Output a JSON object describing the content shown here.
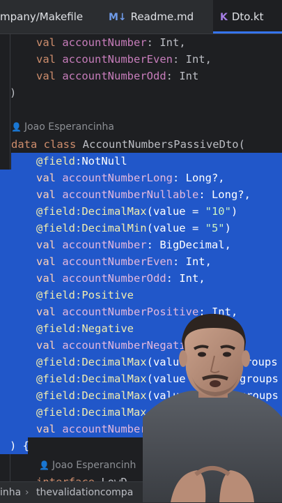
{
  "tabs": [
    {
      "label": "mpany/Makefile",
      "icon": "",
      "active": false
    },
    {
      "label": "Readme.md",
      "icon": "M↓",
      "active": false
    },
    {
      "label": "Dto.kt",
      "icon": "K",
      "active": true
    }
  ],
  "code": {
    "l1_kw": "val",
    "l1_prop": "accountNumber",
    "l1_rest": ": Int,",
    "l2_kw": "val",
    "l2_prop": "accountNumberEven",
    "l2_rest": ": Int,",
    "l3_kw": "val",
    "l3_prop": "accountNumberOdd",
    "l3_rest": ": Int",
    "l4": ")",
    "author1": "Joao Esperancinha",
    "l5_kw": "data class",
    "l5_rest": " AccountNumbersPassiveDto(",
    "l6_ann": "@field",
    "l6_rest": ":NotNull",
    "l7_kw": "val",
    "l7_prop": "accountNumberLong",
    "l7_rest": ": Long?,",
    "l8_kw": "val",
    "l8_prop": "accountNumberNullable",
    "l8_rest": ": Long?,",
    "l9_ann": "@field:DecimalMax",
    "l9_a": "(value = ",
    "l9_str": "\"10\"",
    "l9_b": ")",
    "l10_ann": "@field:DecimalMin",
    "l10_a": "(value = ",
    "l10_str": "\"5\"",
    "l10_b": ")",
    "l11_kw": "val",
    "l11_prop": "accountNumber",
    "l11_rest": ": BigDecimal,",
    "l12_kw": "val",
    "l12_prop": "accountNumberEven",
    "l12_rest": ": Int,",
    "l13_kw": "val",
    "l13_prop": "accountNumberOdd",
    "l13_rest": ": Int,",
    "l14_ann": "@field:Positive",
    "l15_kw": "val",
    "l15_prop": "accountNumberPositive",
    "l15_rest": ": Int,",
    "l16_ann": "@field:Negative",
    "l17_kw": "val",
    "l17_prop": "accountNumberNegati",
    "l18_ann": "@field:DecimalMax",
    "l18_rest": "(value",
    "l18_tail": "roups =",
    "l19_ann": "@field:DecimalMax",
    "l19_rest": "(value",
    "l19_tail": "groups",
    "l20_ann": "@field:DecimalMax",
    "l20_rest": "(value",
    "l20_tail": "groups",
    "l21_ann": "@field:DecimalMax",
    "l22_kw": "val",
    "l22_prop": "accountNumber",
    "l23": ") {",
    "author2": "Joao Esperancinh",
    "l24_kw": "interface",
    "l24_rest": " LowD"
  },
  "status": {
    "crumb1": "inha",
    "crumb2": "thevalidationcompa"
  },
  "colors": {
    "accent": "#3574f0",
    "selection": "#2157c9",
    "editor_bg": "#1e1f22"
  }
}
